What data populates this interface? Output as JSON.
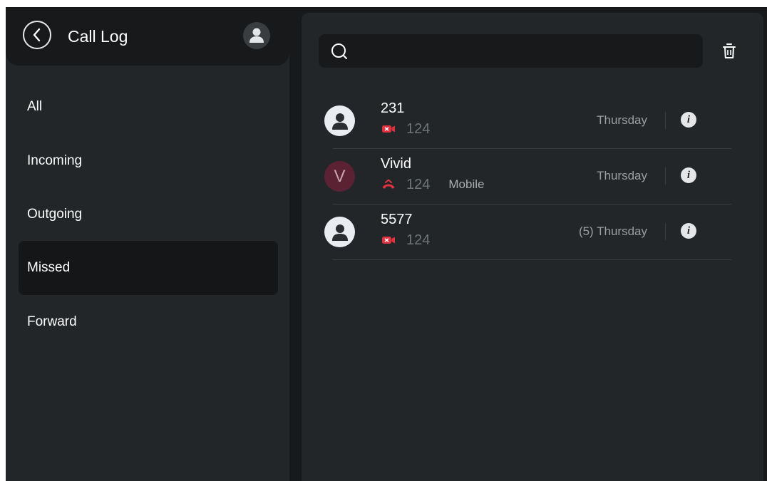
{
  "header": {
    "title": "Call Log",
    "back_icon": "chevron-left-icon",
    "avatar_icon": "person-icon"
  },
  "sidebar": {
    "items": [
      {
        "label": "All",
        "active": false
      },
      {
        "label": "Incoming",
        "active": false
      },
      {
        "label": "Outgoing",
        "active": false
      },
      {
        "label": "Missed",
        "active": true
      },
      {
        "label": "Forward",
        "active": false
      }
    ]
  },
  "search": {
    "value": "",
    "placeholder": "",
    "icon": "search-icon"
  },
  "toolbar": {
    "delete_icon": "trash-icon"
  },
  "calls": [
    {
      "name": "231",
      "avatar": "person-icon",
      "avatar_letter": "",
      "type_icon": "missed-video-call-icon",
      "number": "124",
      "label": "",
      "time": "Thursday"
    },
    {
      "name": "Vivid",
      "avatar": "letter",
      "avatar_letter": "V",
      "type_icon": "missed-call-icon",
      "number": "124",
      "label": "Mobile",
      "time": "Thursday"
    },
    {
      "name": "5577",
      "avatar": "person-icon",
      "avatar_letter": "",
      "type_icon": "missed-video-call-icon",
      "number": "124",
      "label": "",
      "time": "(5) Thursday"
    }
  ],
  "colors": {
    "background": "#17191b",
    "panel": "#232628",
    "missed_red": "#e0323e",
    "text": "#ffffff",
    "muted": "#9a9ea1"
  }
}
